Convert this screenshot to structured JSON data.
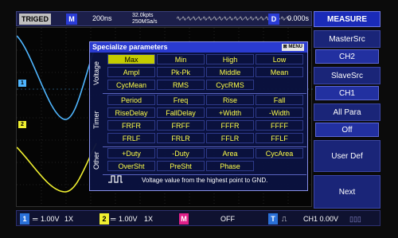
{
  "topbar": {
    "trigger_status": "TRIGED",
    "mode_badge": "M",
    "timebase": "200ns",
    "memory_depth": "32.0kpts",
    "sample_rate": "250MSa/s",
    "delay_badge": "D",
    "time_offset": "0.000s"
  },
  "menu": {
    "title": "MEASURE",
    "items": [
      {
        "label": "MasterSrc",
        "value": "CH2"
      },
      {
        "label": "SlaveSrc",
        "value": "CH1"
      },
      {
        "label": "All Para",
        "value": "Off"
      },
      {
        "label": "User Def"
      },
      {
        "label": "Next"
      }
    ]
  },
  "dialog": {
    "title": "Specialize parameters",
    "menu_label": "MENU",
    "groups": [
      {
        "name": "Voltage",
        "rows": [
          [
            "Max",
            "Min",
            "High",
            "Low"
          ],
          [
            "Ampl",
            "Pk-Pk",
            "Middle",
            "Mean"
          ],
          [
            "CycMean",
            "RMS",
            "CycRMS",
            ""
          ]
        ]
      },
      {
        "name": "Timer",
        "rows": [
          [
            "Period",
            "Freq",
            "Rise",
            "Fall"
          ],
          [
            "RiseDelay",
            "FallDelay",
            "+Width",
            "-Width"
          ],
          [
            "FRFR",
            "FRFF",
            "FFFR",
            "FFFF"
          ],
          [
            "FRLF",
            "FRLR",
            "FFLR",
            "FFLF"
          ]
        ]
      },
      {
        "name": "Other",
        "rows": [
          [
            "+Duty",
            "-Duty",
            "Area",
            "CycArea"
          ],
          [
            "OverSht",
            "PreSht",
            "Phase",
            ""
          ]
        ]
      }
    ],
    "selected": "Max",
    "description": "Voltage value from the highest point to GND."
  },
  "bottombar": {
    "ch1_badge": "1",
    "ch1_scale": "1.00V",
    "ch1_probe": "1X",
    "ch2_badge": "2",
    "ch2_scale": "1.00V",
    "ch2_probe": "1X",
    "math_badge": "M",
    "math_state": "OFF",
    "trig_badge": "T",
    "trig_info": "CH1 0.00V"
  },
  "colors": {
    "ch1": "#4fb6ff",
    "ch2": "#f0f030",
    "accent": "#1a2bb8",
    "selected_cell": "#c4cc00"
  }
}
